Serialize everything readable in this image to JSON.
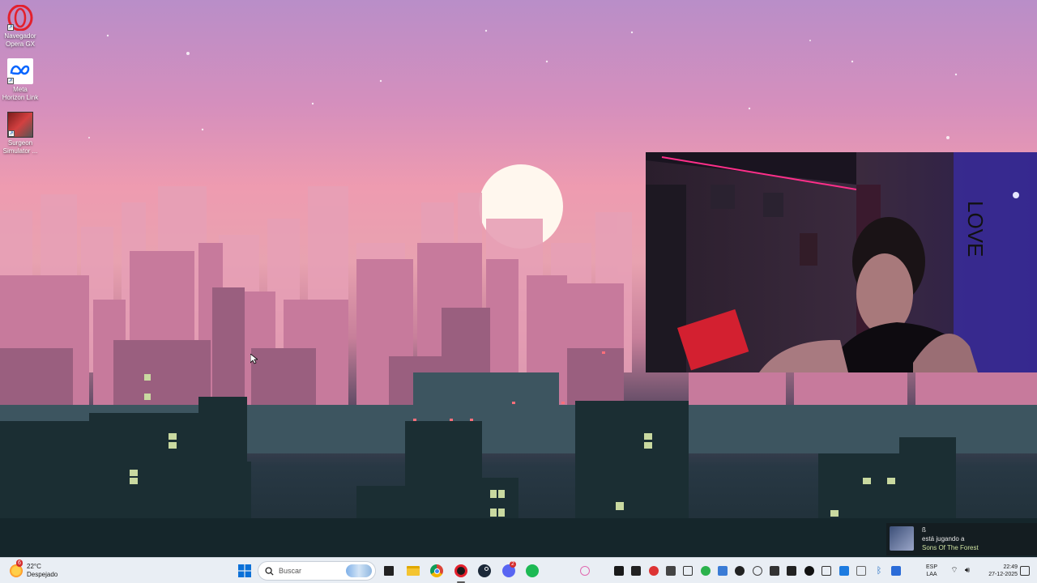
{
  "desktop": {
    "icons": [
      {
        "label": "Navegador Opera GX",
        "icon": "opera-gx-icon"
      },
      {
        "label": "Meta Horizon Link",
        "icon": "meta-icon"
      },
      {
        "label": "Surgeon Simulator ...",
        "icon": "surgeon-simulator-icon"
      }
    ]
  },
  "notification": {
    "user": "ß",
    "status": "está jugando a",
    "game": "Sons Of The Forest"
  },
  "taskbar": {
    "weather": {
      "temp": "22°C",
      "condition": "Despejado",
      "badge": "6"
    },
    "search_placeholder": "Buscar",
    "apps": [
      "windows-start-icon",
      "task-view-icon",
      "file-explorer-icon",
      "chrome-icon",
      "opera-gx-icon",
      "steam-icon",
      "discord-icon",
      "spotify-icon"
    ],
    "discord_badge": "2",
    "tray": {
      "language": "ESP",
      "region": "LAA",
      "time": "22:49",
      "date": "27-12-2025"
    }
  },
  "colors": {
    "sky_top": "#b98ec8",
    "sky_horizon": "#ee9bb0",
    "city_dark": "#1a2a30",
    "taskbar_bg": "#e9eef4",
    "spotify_green": "#1db954",
    "opera_red": "#e3202c"
  }
}
